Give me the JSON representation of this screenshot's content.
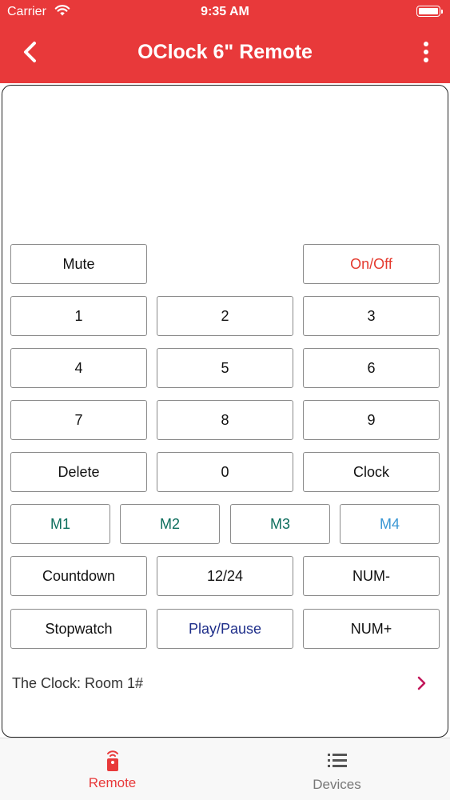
{
  "status_bar": {
    "carrier": "Carrier",
    "time": "9:35 AM"
  },
  "nav": {
    "title": "OClock 6\" Remote"
  },
  "buttons": {
    "mute": "Mute",
    "onoff": "On/Off",
    "n1": "1",
    "n2": "2",
    "n3": "3",
    "n4": "4",
    "n5": "5",
    "n6": "6",
    "n7": "7",
    "n8": "8",
    "n9": "9",
    "delete": "Delete",
    "n0": "0",
    "clock": "Clock",
    "m1": "M1",
    "m2": "M2",
    "m3": "M3",
    "m4": "M4",
    "countdown": "Countdown",
    "mode1224": "12/24",
    "num_minus": "NUM-",
    "stopwatch": "Stopwatch",
    "playpause": "Play/Pause",
    "num_plus": "NUM+"
  },
  "device": {
    "label": "The Clock: Room 1#"
  },
  "tabs": [
    {
      "label": "Remote",
      "icon": "remote-icon",
      "active": true
    },
    {
      "label": "Devices",
      "icon": "list-icon",
      "active": false
    }
  ],
  "colors": {
    "brand": "#e8393a",
    "teal": "#0d6e5d",
    "blue": "#3a97d4",
    "navy": "#1f2f8a"
  }
}
